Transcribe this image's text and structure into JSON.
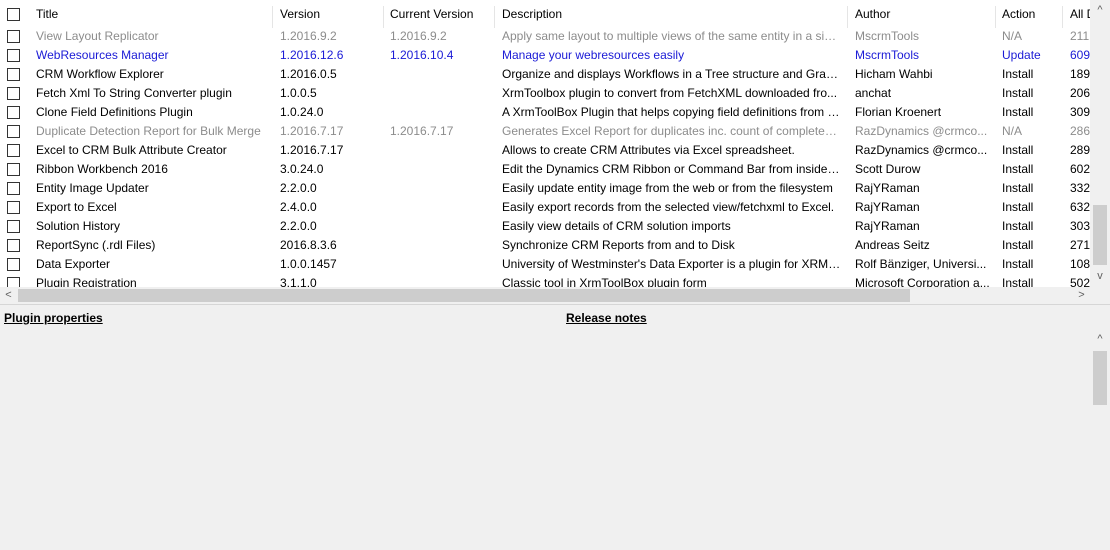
{
  "columns": {
    "title": "Title",
    "version": "Version",
    "current_version": "Current Version",
    "description": "Description",
    "author": "Author",
    "action": "Action",
    "all": "All D"
  },
  "rows": [
    {
      "title": "View Layout Replicator",
      "version": "1.2016.9.2",
      "current": "1.2016.9.2",
      "description": "Apply same layout to multiple views of the same entity in a singl...",
      "author": "MscrmTools",
      "action": "N/A",
      "all": "211",
      "style": "gray"
    },
    {
      "title": "WebResources Manager",
      "version": "1.2016.12.6",
      "current": "1.2016.10.4",
      "description": "Manage your webresources easily",
      "author": "MscrmTools",
      "action": "Update",
      "all": "609",
      "style": "blue"
    },
    {
      "title": "CRM Workflow Explorer",
      "version": "1.2016.0.5",
      "current": "",
      "description": "Organize and displays Workflows in a Tree structure and Graphs",
      "author": "Hicham Wahbi",
      "action": "Install",
      "all": "189",
      "style": "normal"
    },
    {
      "title": "Fetch Xml To String Converter plugin",
      "version": "1.0.0.5",
      "current": "",
      "description": "XrmToolbox plugin to convert from FetchXML downloaded fro...",
      "author": "anchat",
      "action": "Install",
      "all": "206",
      "style": "normal"
    },
    {
      "title": "Clone Field Definitions Plugin",
      "version": "1.0.24.0",
      "current": "",
      "description": "A XrmToolBox Plugin that helps copying field definitions from a...",
      "author": "Florian Kroenert",
      "action": "Install",
      "all": "309",
      "style": "normal"
    },
    {
      "title": "Duplicate Detection Report for Bulk Merge",
      "version": "1.2016.7.17",
      "current": "1.2016.7.17",
      "description": "Generates Excel Report for duplicates inc. count of completed ...",
      "author": "RazDynamics @crmco...",
      "action": "N/A",
      "all": "286",
      "style": "gray"
    },
    {
      "title": "Excel to CRM Bulk Attribute Creator",
      "version": "1.2016.7.17",
      "current": "",
      "description": "Allows to create CRM Attributes via Excel spreadsheet.",
      "author": "RazDynamics @crmco...",
      "action": "Install",
      "all": "289",
      "style": "normal"
    },
    {
      "title": "Ribbon Workbench 2016",
      "version": "3.0.24.0",
      "current": "",
      "description": "Edit the Dynamics CRM Ribbon or Command Bar from inside th...",
      "author": "Scott Durow",
      "action": "Install",
      "all": "602",
      "style": "normal"
    },
    {
      "title": "Entity Image Updater",
      "version": "2.2.0.0",
      "current": "",
      "description": "Easily update entity image from the web or from the filesystem",
      "author": "RajYRaman",
      "action": "Install",
      "all": "332",
      "style": "normal"
    },
    {
      "title": "Export to Excel",
      "version": "2.4.0.0",
      "current": "",
      "description": "Easily export records from the selected view/fetchxml to Excel.",
      "author": "RajYRaman",
      "action": "Install",
      "all": "632",
      "style": "normal"
    },
    {
      "title": "Solution History",
      "version": "2.2.0.0",
      "current": "",
      "description": "Easily view details of CRM solution imports",
      "author": "RajYRaman",
      "action": "Install",
      "all": "303",
      "style": "normal"
    },
    {
      "title": "ReportSync (.rdl Files)",
      "version": "2016.8.3.6",
      "current": "",
      "description": "Synchronize CRM Reports from and to Disk",
      "author": "Andreas Seitz",
      "action": "Install",
      "all": "271",
      "style": "normal"
    },
    {
      "title": "Data Exporter",
      "version": "1.0.0.1457",
      "current": "",
      "description": "University of Westminster's Data Exporter is a plugin for XRM T...",
      "author": "Rolf Bänziger,  Universi...",
      "action": "Install",
      "all": "108",
      "style": "normal"
    },
    {
      "title": "Plugin Registration",
      "version": "3.1.1.0",
      "current": "",
      "description": "Classic tool in XrmToolBox plugin form",
      "author": "Microsoft Corporation a...",
      "action": "Install",
      "all": "502",
      "style": "normal"
    }
  ],
  "scroll": {
    "up_icon": "^",
    "down_icon": "v",
    "left_icon": "<",
    "right_icon": ">"
  },
  "bottom": {
    "plugin_properties": "Plugin properties",
    "release_notes": "Release notes"
  },
  "colors": {
    "gray": "#8c8c8c",
    "blue": "#1a1ad6"
  }
}
